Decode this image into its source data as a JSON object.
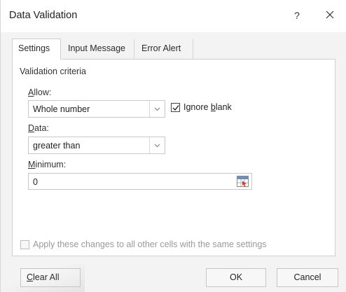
{
  "dialog": {
    "title": "Data Validation",
    "help_label": "?",
    "close_icon": "close-icon"
  },
  "tabs": [
    {
      "label": "Settings",
      "active": true
    },
    {
      "label": "Input Message",
      "active": false
    },
    {
      "label": "Error Alert",
      "active": false
    }
  ],
  "settings": {
    "section_title": "Validation criteria",
    "allow_label": "Allow:",
    "allow_value": "Whole number",
    "ignore_blank_label": "Ignore blank",
    "ignore_blank_checked": true,
    "data_label": "Data:",
    "data_value": "greater than",
    "minimum_label": "Minimum:",
    "minimum_value": "0",
    "refedit_icon": "range-select-icon"
  },
  "apply": {
    "label": "Apply these changes to all other cells with the same settings",
    "checked": false,
    "enabled": false
  },
  "buttons": {
    "clear_all": "Clear All",
    "ok": "OK",
    "cancel": "Cancel"
  },
  "colors": {
    "dialog_bg": "#f3f3f3",
    "panel_bg": "#ffffff",
    "disabled_text": "#9a9a9a"
  }
}
